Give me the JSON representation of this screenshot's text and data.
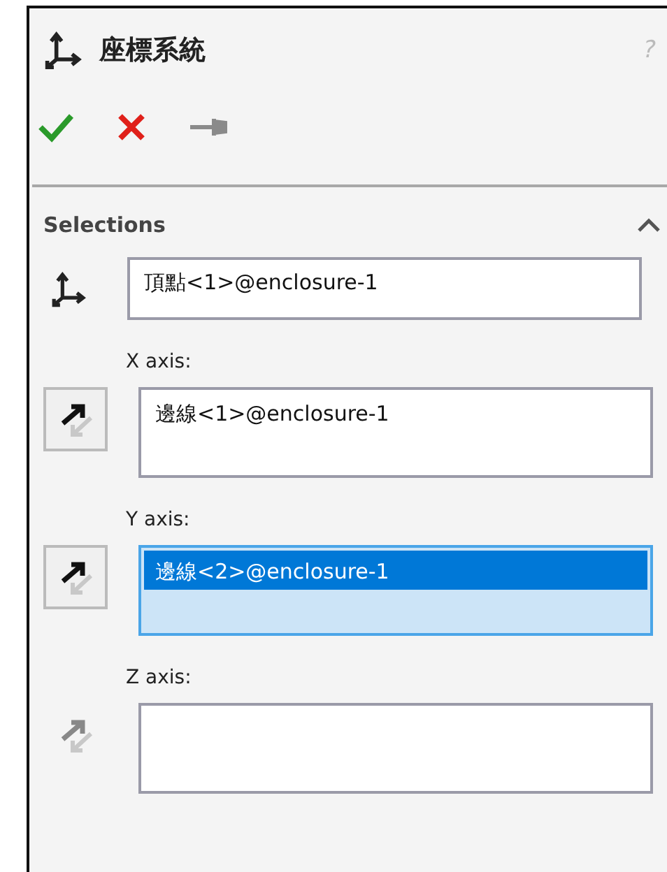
{
  "title": "座標系統",
  "help": "?",
  "section": {
    "title": "Selections",
    "expanded": true,
    "fields": [
      {
        "kind": "point",
        "value": "頂點<1>@enclosure-1",
        "active": false
      },
      {
        "kind": "axis",
        "label": "X axis:",
        "value": "邊線<1>@enclosure-1",
        "active": false,
        "enabled": true
      },
      {
        "kind": "axis",
        "label": "Y axis:",
        "value": "邊線<2>@enclosure-1",
        "active": true,
        "enabled": true
      },
      {
        "kind": "axis",
        "label": "Z axis:",
        "active": false,
        "enabled": false
      }
    ]
  }
}
